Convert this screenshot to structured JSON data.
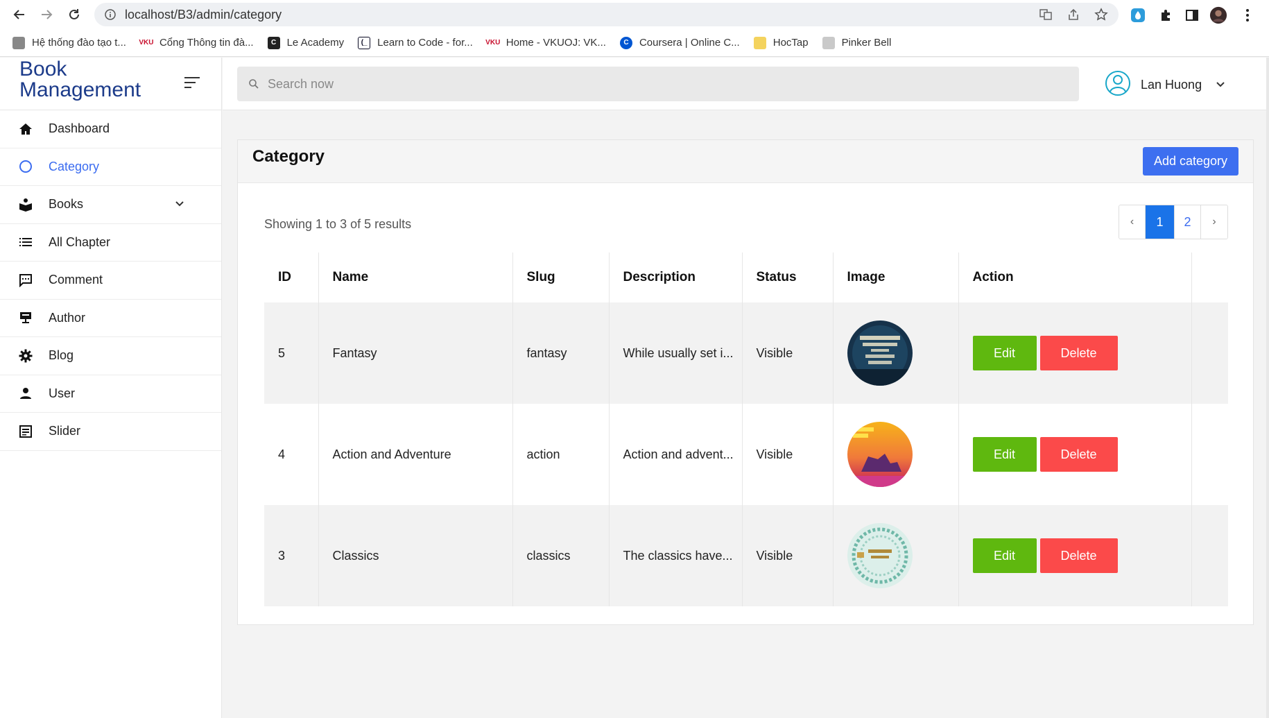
{
  "browser": {
    "url": "localhost/B3/admin/category",
    "bookmarks": [
      {
        "label": "Hệ thống đào tạo t...",
        "icon": "page-icon",
        "color": "#777777"
      },
      {
        "label": "Cổng Thông tin đà...",
        "icon": "vku-icon",
        "color": "#c8102e"
      },
      {
        "label": "Le Academy",
        "icon": "c-icon",
        "color": "#222222"
      },
      {
        "label": "Learn to Code - for...",
        "icon": "code-icon",
        "color": "#0a0a23"
      },
      {
        "label": "Home - VKUOJ: VK...",
        "icon": "vku-icon",
        "color": "#c8102e"
      },
      {
        "label": "Coursera | Online C...",
        "icon": "coursera-icon",
        "color": "#0056d2"
      },
      {
        "label": "HocTap",
        "icon": "folder-icon",
        "color": "#f4c542"
      },
      {
        "label": "Pinker Bell",
        "icon": "image-icon",
        "color": "#999999"
      }
    ]
  },
  "sidebar": {
    "brand": "Book Management",
    "items": [
      {
        "label": "Dashboard",
        "icon": "home-icon",
        "active": false
      },
      {
        "label": "Category",
        "icon": "circle-icon",
        "active": true
      },
      {
        "label": "Books",
        "icon": "book-icon",
        "active": false,
        "expandable": true
      },
      {
        "label": "All Chapter",
        "icon": "list-icon",
        "active": false
      },
      {
        "label": "Comment",
        "icon": "comment-icon",
        "active": false
      },
      {
        "label": "Author",
        "icon": "presenter-icon",
        "active": false
      },
      {
        "label": "Blog",
        "icon": "gear-icon",
        "active": false
      },
      {
        "label": "User",
        "icon": "user-icon",
        "active": false
      },
      {
        "label": "Slider",
        "icon": "document-icon",
        "active": false
      }
    ]
  },
  "header": {
    "search_placeholder": "Search now",
    "user_name": "Lan Huong"
  },
  "main": {
    "title": "Category",
    "add_label": "Add category",
    "showing": "Showing 1 to 3 of 5 results",
    "pagination": {
      "prev": "‹",
      "pages": [
        "1",
        "2"
      ],
      "current": "1",
      "next": "›"
    },
    "columns": [
      "ID",
      "Name",
      "Slug",
      "Description",
      "Status",
      "Image",
      "Action",
      ""
    ],
    "rows": [
      {
        "id": "5",
        "name": "Fantasy",
        "slug": "fantasy",
        "description": "While usually set i...",
        "status": "Visible",
        "image": "book-cover-water-dancer",
        "edit": "Edit",
        "delete": "Delete"
      },
      {
        "id": "4",
        "name": "Action and Adventure",
        "slug": "action",
        "description": "Action and advent...",
        "status": "Visible",
        "image": "book-cover-horse-riders",
        "edit": "Edit",
        "delete": "Delete"
      },
      {
        "id": "3",
        "name": "Classics",
        "slug": "classics",
        "description": "The classics have...",
        "status": "Visible",
        "image": "book-cover-little-women",
        "edit": "Edit",
        "delete": "Delete"
      }
    ]
  },
  "colors": {
    "brand": "#1c3b8a",
    "primary": "#3d6ff0",
    "edit": "#5fb80f",
    "delete": "#fb4a4a",
    "active_page": "#1a73e8"
  }
}
